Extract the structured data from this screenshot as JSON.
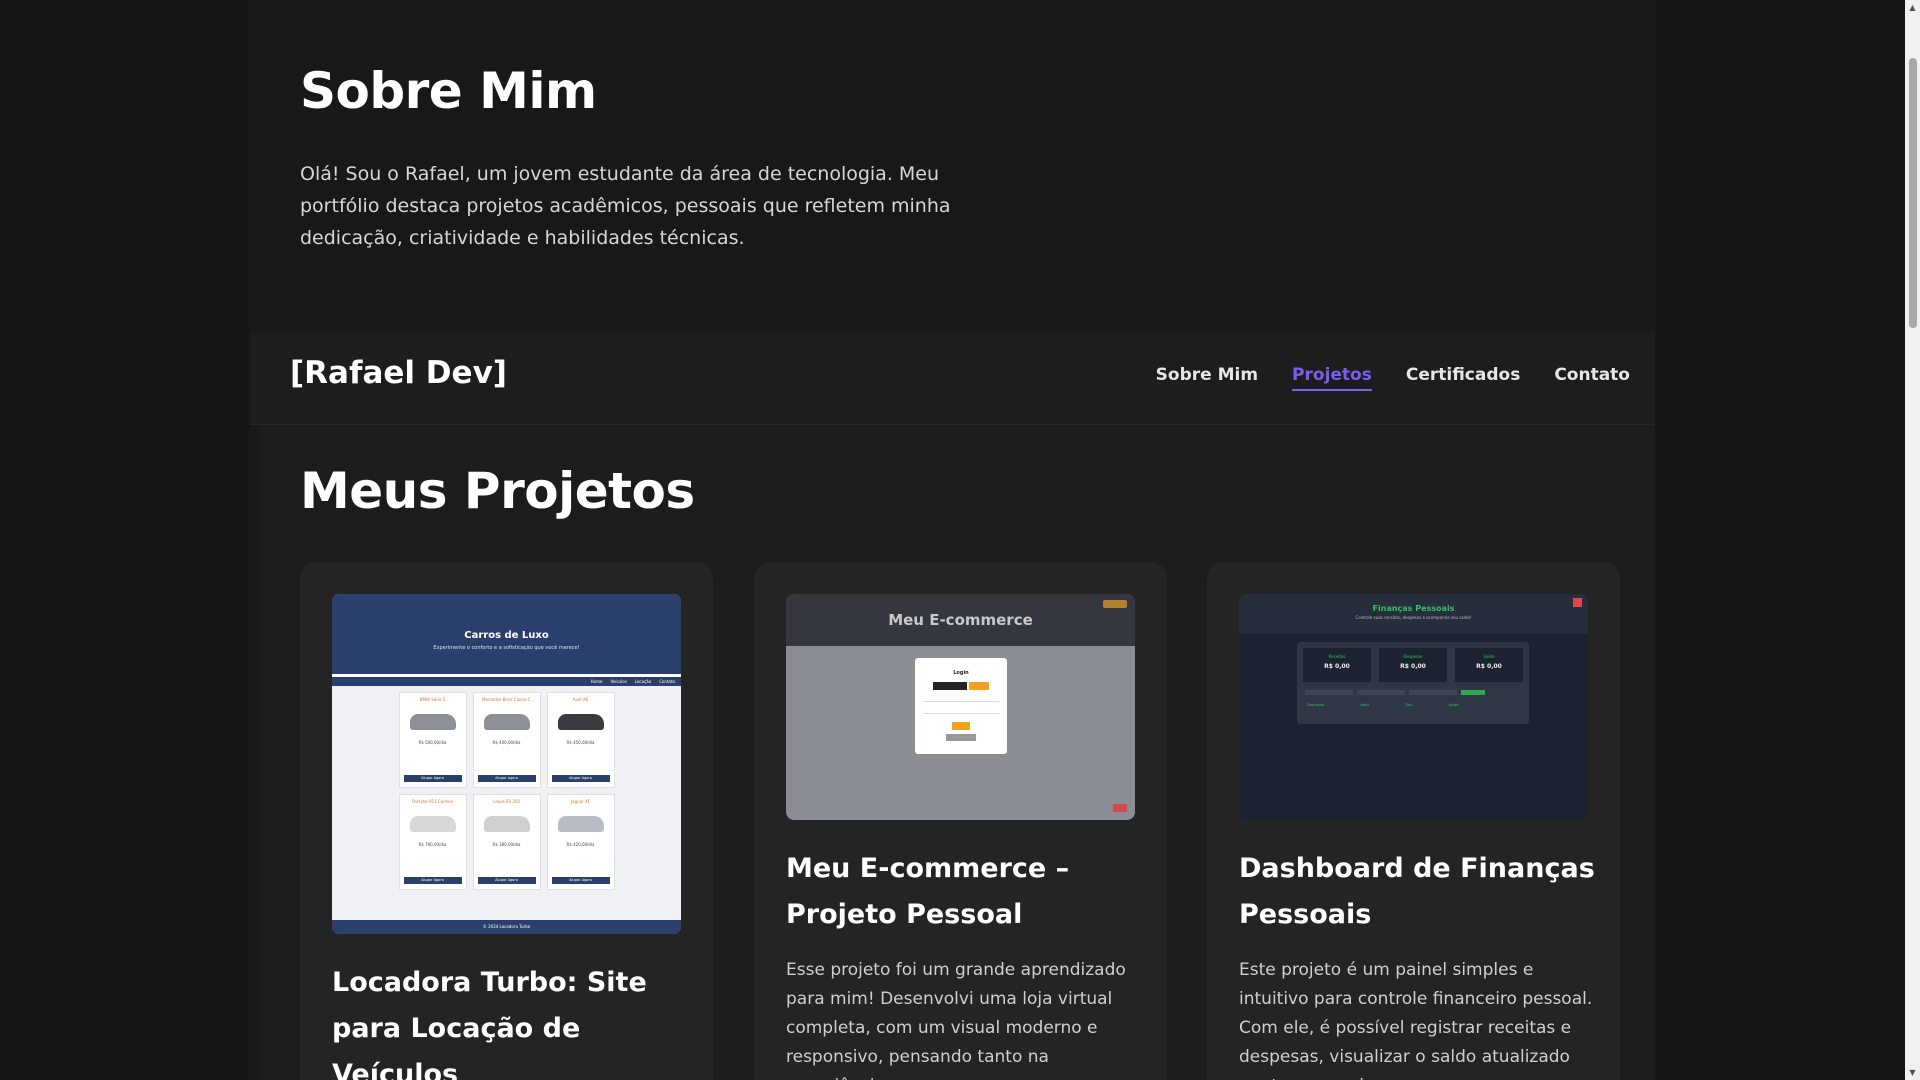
{
  "about": {
    "title": "Sobre Mim",
    "text": "Olá! Sou o Rafael, um jovem estudante da área de tecnologia. Meu portfólio destaca projetos acadêmicos, pessoais que refletem minha dedicação, criatividade e habilidades técnicas."
  },
  "nav": {
    "brand": "[Rafael Dev]",
    "links": [
      {
        "label": "Sobre Mim"
      },
      {
        "label": "Projetos"
      },
      {
        "label": "Certificados"
      },
      {
        "label": "Contato"
      }
    ],
    "active_color": "#7b5cf0"
  },
  "projects": {
    "title": "Meus Projetos",
    "cards": [
      {
        "title": "Locadora Turbo: Site para Locação de Veículos",
        "description": "",
        "thumb": {
          "heading": "Carros de Luxo",
          "subheading": "Experimente o conforto e a sofisticação que você merece!",
          "nav": [
            "Home",
            "Veículos",
            "Locação",
            "Contato"
          ],
          "cars": [
            {
              "name": "BMW Série 5",
              "price": "R$ 500,00/dia",
              "button": "Alugar Agora"
            },
            {
              "name": "Mercedes-Benz Classe C",
              "price": "R$ 400,00/dia",
              "button": "Alugar Agora"
            },
            {
              "name": "Audi A6",
              "price": "R$ 450,00/dia",
              "button": "Alugar Agora"
            },
            {
              "name": "Porsche 911 Carrera",
              "price": "R$ 700,00/dia",
              "button": "Alugar Agora"
            },
            {
              "name": "Lexus ES 350",
              "price": "R$ 380,00/dia",
              "button": "Alugar Agora"
            },
            {
              "name": "Jaguar XF",
              "price": "R$ 420,00/dia",
              "button": "Alugar Agora"
            }
          ],
          "footer": "© 2024 Locadora Turbo"
        }
      },
      {
        "title": "Meu E-commerce – Projeto Pessoal",
        "description": "Esse projeto foi um grande aprendizado para mim! Desenvolvi uma loja virtual completa, com um visual moderno e responsivo, pensando tanto na experiência",
        "thumb": {
          "heading": "Meu E-commerce",
          "login_title": "Login",
          "tab_admin": "Administrador",
          "tab_user": "Usuário",
          "submit": "Entrar",
          "register": "Cadastre-se"
        }
      },
      {
        "title": "Dashboard de Finanças Pessoais",
        "description": "Este projeto é um painel simples e intuitivo para controle financeiro pessoal. Com ele, é possível registrar receitas e despesas, visualizar o saldo atualizado em tempo real",
        "thumb": {
          "heading": "Finanças Pessoais",
          "subheading": "Controle suas receitas, despesas e acompanhe seu saldo!",
          "stats": [
            {
              "label": "Receitas",
              "value": "R$ 0,00"
            },
            {
              "label": "Despesas",
              "value": "R$ 0,00"
            },
            {
              "label": "Saldo",
              "value": "R$ 0,00"
            }
          ],
          "add_button": "Adicionar",
          "columns": [
            "Descrição",
            "Valor",
            "Tipo",
            "Ações"
          ]
        }
      }
    ]
  },
  "colors": {
    "background": "#161616",
    "card": "#242424",
    "accent": "#7b5cf0"
  }
}
